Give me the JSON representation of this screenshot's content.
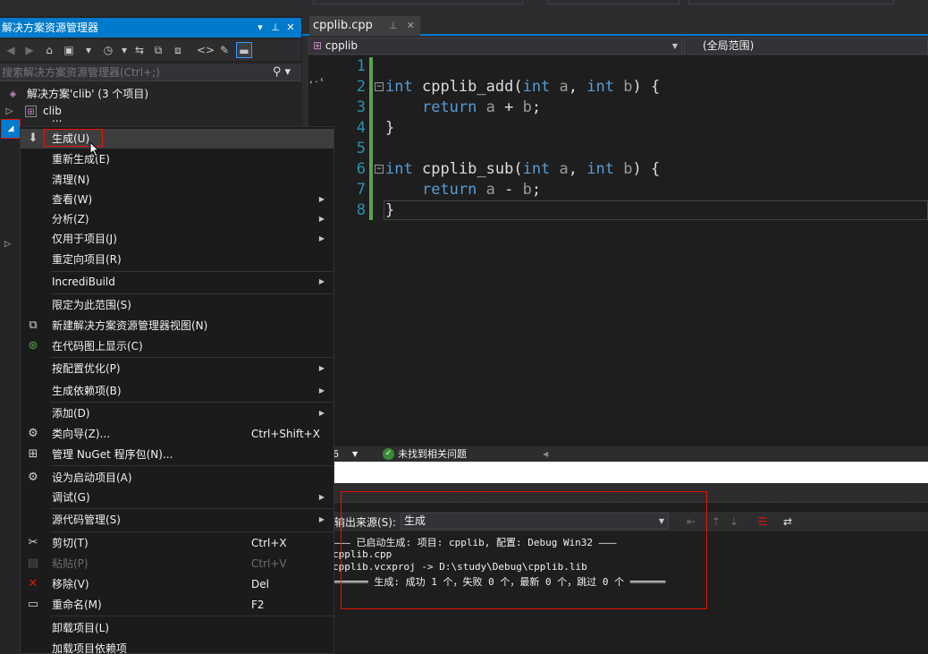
{
  "solution_explorer": {
    "title": "解决方案资源管理器",
    "search_placeholder": "搜索解决方案资源管理器(Ctrl+;)",
    "solution_label": "解决方案'clib' (3 个项目)",
    "items": [
      {
        "label": "clib"
      },
      {
        "label": "..."
      }
    ]
  },
  "editor": {
    "tab_label": "cpplib.cpp",
    "nav_project": "cpplib",
    "nav_scope": "(全局范围)",
    "line_numbers": [
      "1",
      "2",
      "3",
      "4",
      "5",
      "6",
      "7",
      "8"
    ]
  },
  "status": {
    "zoom_partial": "6",
    "issues_text": "未找到相关问题"
  },
  "output": {
    "source_label": "输出来源(S):",
    "source_value": "生成",
    "lines": [
      "——— 已启动生成: 项目: cpplib, 配置: Debug Win32 ———",
      "cpplib.cpp",
      "cpplib.vcxproj -> D:\\study\\Debug\\cpplib.lib",
      "══════ 生成: 成功 1 个，失败 0 个，最新 0 个，跳过 0 个 ══════"
    ]
  },
  "context_menu": {
    "items": [
      {
        "label": "生成(U)"
      },
      {
        "label": "重新生成(E)"
      },
      {
        "label": "清理(N)"
      },
      {
        "label": "查看(W)"
      },
      {
        "label": "分析(Z)"
      },
      {
        "label": "仅用于项目(J)"
      },
      {
        "label": "重定向项目(R)"
      },
      {
        "label": "IncrediBuild"
      },
      {
        "label": "限定为此范围(S)"
      },
      {
        "label": "新建解决方案资源管理器视图(N)"
      },
      {
        "label": "在代码图上显示(C)"
      },
      {
        "label": "按配置优化(P)"
      },
      {
        "label": "生成依赖项(B)"
      },
      {
        "label": "添加(D)"
      },
      {
        "label": "类向导(Z)...",
        "shortcut": "Ctrl+Shift+X"
      },
      {
        "label": "管理 NuGet 程序包(N)..."
      },
      {
        "label": "设为启动项目(A)"
      },
      {
        "label": "调试(G)"
      },
      {
        "label": "源代码管理(S)"
      },
      {
        "label": "剪切(T)",
        "shortcut": "Ctrl+X"
      },
      {
        "label": "粘贴(P)",
        "shortcut": "Ctrl+V"
      },
      {
        "label": "移除(V)",
        "shortcut": "Del"
      },
      {
        "label": "重命名(M)",
        "shortcut": "F2"
      },
      {
        "label": "卸载项目(L)"
      },
      {
        "label": "加载项目依赖项"
      }
    ]
  },
  "colors": {
    "accent": "#007acc",
    "highlight_box": "#e51400",
    "keyword": "#569cd6",
    "line_number": "#2b91af",
    "change_bar": "#57a64a"
  }
}
